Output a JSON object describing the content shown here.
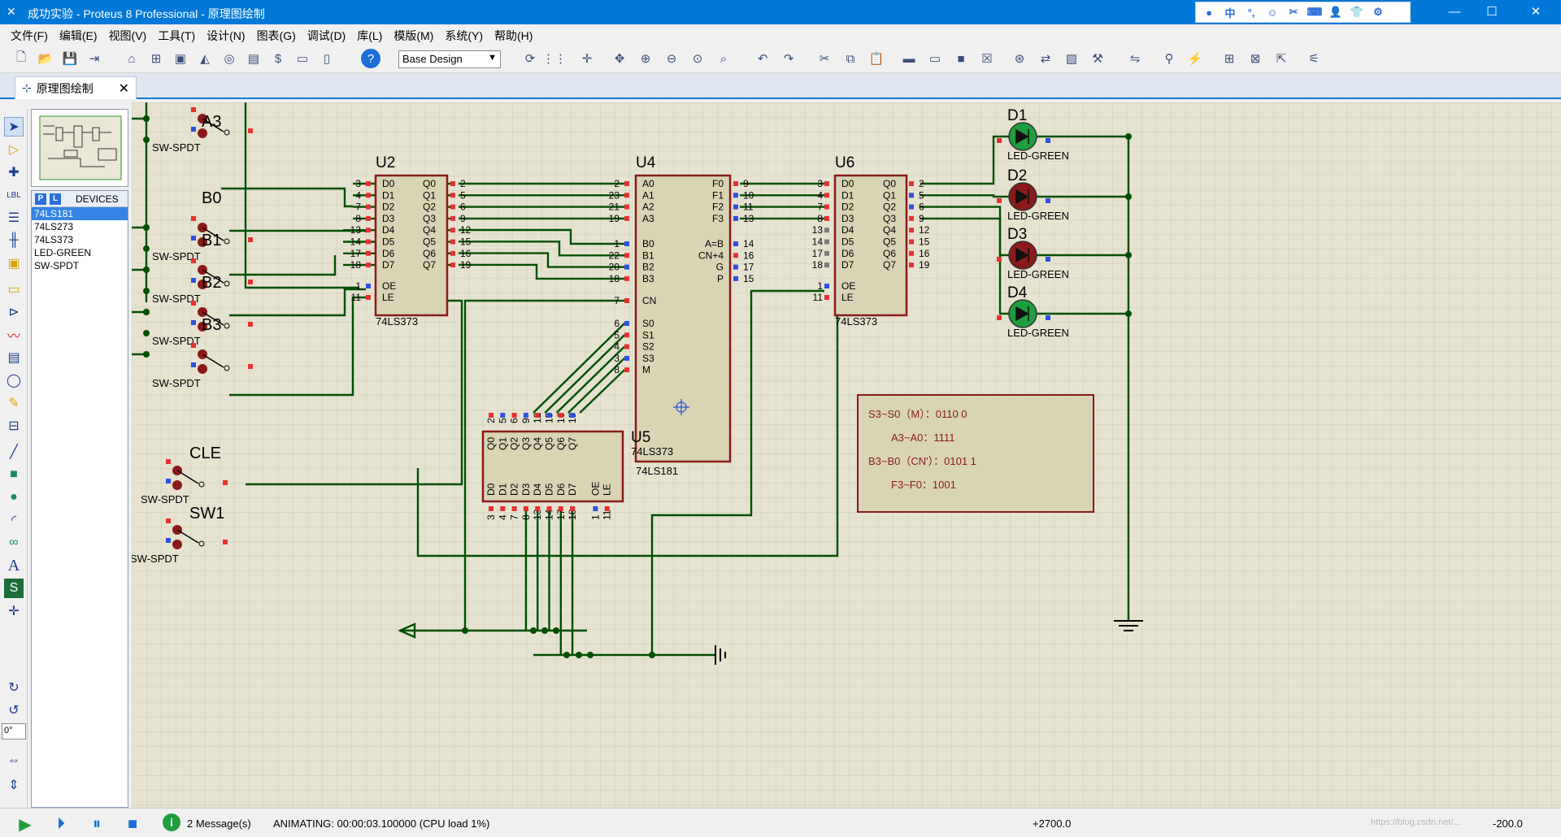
{
  "window": {
    "title": "成功实验 - Proteus 8 Professional - 原理图绘制",
    "minimize": "—",
    "maximize": "☐",
    "close": "✕"
  },
  "ime": [
    "中",
    "°,",
    "☺",
    "✂",
    "⌨",
    "👤",
    "👕",
    "⚙"
  ],
  "menu": [
    "文件(F)",
    "编辑(E)",
    "视图(V)",
    "工具(T)",
    "设计(N)",
    "图表(G)",
    "调试(D)",
    "库(L)",
    "模版(M)",
    "系统(Y)",
    "帮助(H)"
  ],
  "toolbar": {
    "design_select": "Base Design"
  },
  "tab": {
    "label": "原理图绘制",
    "close": "✕"
  },
  "devices": {
    "header": "DEVICES",
    "p_label": "P",
    "l_label": "L",
    "items": [
      "74LS181",
      "74LS273",
      "74LS373",
      "LED-GREEN",
      "SW-SPDT"
    ],
    "selected_index": 0
  },
  "schematic": {
    "switches": [
      {
        "ref": "A3",
        "part": "SW-SPDT"
      },
      {
        "ref": "B0",
        "part": "SW-SPDT"
      },
      {
        "ref": "B1",
        "part": "SW-SPDT"
      },
      {
        "ref": "B2",
        "part": "SW-SPDT"
      },
      {
        "ref": "B3",
        "part": "SW-SPDT"
      },
      {
        "ref": "CLE",
        "part": "SW-SPDT"
      },
      {
        "ref": "SW1",
        "part": "SW-SPDT"
      }
    ],
    "sw_part_label": "SW-SPDT",
    "u2": {
      "ref": "U2",
      "part": "74LS373",
      "left_pins": [
        {
          "n": "3",
          "name": "D0"
        },
        {
          "n": "4",
          "name": "D1"
        },
        {
          "n": "7",
          "name": "D2"
        },
        {
          "n": "8",
          "name": "D3"
        },
        {
          "n": "13",
          "name": "D4"
        },
        {
          "n": "14",
          "name": "D5"
        },
        {
          "n": "17",
          "name": "D6"
        },
        {
          "n": "18",
          "name": "D7"
        }
      ],
      "right_pins": [
        {
          "n": "2",
          "name": "Q0"
        },
        {
          "n": "5",
          "name": "Q1"
        },
        {
          "n": "6",
          "name": "Q2"
        },
        {
          "n": "9",
          "name": "Q3"
        },
        {
          "n": "12",
          "name": "Q4"
        },
        {
          "n": "15",
          "name": "Q5"
        },
        {
          "n": "16",
          "name": "Q6"
        },
        {
          "n": "19",
          "name": "Q7"
        }
      ],
      "ctrl_pins": [
        {
          "n": "1",
          "name": "OE"
        },
        {
          "n": "11",
          "name": "LE"
        }
      ]
    },
    "u4": {
      "ref": "U4",
      "part": "74LS181",
      "a_pins": [
        {
          "n": "2",
          "name": "A0"
        },
        {
          "n": "23",
          "name": "A1"
        },
        {
          "n": "21",
          "name": "A2"
        },
        {
          "n": "19",
          "name": "A3"
        }
      ],
      "b_pins": [
        {
          "n": "1",
          "name": "B0"
        },
        {
          "n": "22",
          "name": "B1"
        },
        {
          "n": "20",
          "name": "B2"
        },
        {
          "n": "18",
          "name": "B3"
        }
      ],
      "cn_pin": {
        "n": "7",
        "name": "CN"
      },
      "s_pins": [
        {
          "n": "6",
          "name": "S0"
        },
        {
          "n": "5",
          "name": "S1"
        },
        {
          "n": "4",
          "name": "S2"
        },
        {
          "n": "3",
          "name": "S3"
        },
        {
          "n": "8",
          "name": "M"
        }
      ],
      "f_pins": [
        {
          "n": "9",
          "name": "F0"
        },
        {
          "n": "10",
          "name": "F1"
        },
        {
          "n": "11",
          "name": "F2"
        },
        {
          "n": "13",
          "name": "F3"
        }
      ],
      "r_pins": [
        {
          "n": "14",
          "name": "A=B"
        },
        {
          "n": "16",
          "name": "CN+4"
        },
        {
          "n": "17",
          "name": "G"
        },
        {
          "n": "15",
          "name": "P"
        }
      ]
    },
    "u5": {
      "ref": "U5",
      "part": "74LS373",
      "top_pins": [
        {
          "n": "2",
          "name": "Q0"
        },
        {
          "n": "5",
          "name": "Q1"
        },
        {
          "n": "6",
          "name": "Q2"
        },
        {
          "n": "9",
          "name": "Q3"
        },
        {
          "n": "12",
          "name": "Q4"
        },
        {
          "n": "15",
          "name": "Q5"
        },
        {
          "n": "16",
          "name": "Q6"
        },
        {
          "n": "19",
          "name": "Q7"
        }
      ],
      "bottom_pins": [
        {
          "n": "3",
          "name": "D0"
        },
        {
          "n": "4",
          "name": "D1"
        },
        {
          "n": "7",
          "name": "D2"
        },
        {
          "n": "8",
          "name": "D3"
        },
        {
          "n": "13",
          "name": "D4"
        },
        {
          "n": "14",
          "name": "D5"
        },
        {
          "n": "17",
          "name": "D6"
        },
        {
          "n": "18",
          "name": "D7"
        },
        {
          "n": "1",
          "name": "OE"
        },
        {
          "n": "11",
          "name": "LE"
        }
      ]
    },
    "u6": {
      "ref": "U6",
      "part": "74LS373",
      "left_pins": [
        {
          "n": "3",
          "name": "D0"
        },
        {
          "n": "4",
          "name": "D1"
        },
        {
          "n": "7",
          "name": "D2"
        },
        {
          "n": "8",
          "name": "D3"
        },
        {
          "n": "13",
          "name": "D4"
        },
        {
          "n": "14",
          "name": "D5"
        },
        {
          "n": "17",
          "name": "D6"
        },
        {
          "n": "18",
          "name": "D7"
        }
      ],
      "right_pins": [
        {
          "n": "2",
          "name": "Q0"
        },
        {
          "n": "5",
          "name": "Q1"
        },
        {
          "n": "6",
          "name": "Q2"
        },
        {
          "n": "9",
          "name": "Q3"
        },
        {
          "n": "12",
          "name": "Q4"
        },
        {
          "n": "15",
          "name": "Q5"
        },
        {
          "n": "16",
          "name": "Q6"
        },
        {
          "n": "19",
          "name": "Q7"
        }
      ],
      "ctrl_pins": [
        {
          "n": "1",
          "name": "OE"
        },
        {
          "n": "11",
          "name": "LE"
        }
      ]
    },
    "leds": [
      {
        "ref": "D1",
        "part": "LED-GREEN",
        "lit": true
      },
      {
        "ref": "D2",
        "part": "LED-GREEN",
        "lit": false
      },
      {
        "ref": "D3",
        "part": "LED-GREEN",
        "lit": false
      },
      {
        "ref": "D4",
        "part": "LED-GREEN",
        "lit": true
      }
    ],
    "note_lines": [
      "S3~S0（M）：0110 0",
      "A3~A0：1111",
      "B3~B0（CN'）：0101 1",
      "F3~F0：1001"
    ],
    "colors": {
      "wire": "#005000",
      "chip_border": "#8b1a1a",
      "chip_fill": "#d8d4b4",
      "pin_red": "#e83030",
      "pin_blue": "#3050e0",
      "grid_bg": "#e5e3d0",
      "led_on": "#1f9e3e",
      "led_off": "#8b1a1a"
    }
  },
  "status": {
    "messages": "2 Message(s)",
    "animating": "ANIMATING: 00:00:03.100000 (CPU load 1%)",
    "coord_x": "+2700.0",
    "coord_y": "-200.0",
    "zoom_field": "0°",
    "watermark": "https://blog.csdn.net/..."
  }
}
